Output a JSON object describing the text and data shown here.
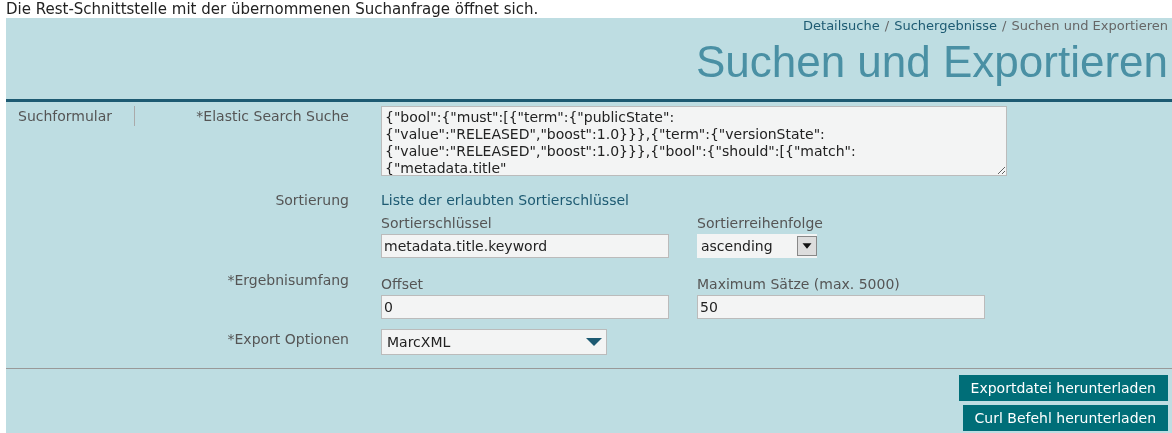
{
  "intro": "Die Rest-Schnittstelle mit der übernommenen Suchanfrage öffnet sich.",
  "breadcrumb": [
    {
      "label": "Detailsuche",
      "link": true
    },
    {
      "label": "/",
      "link": false
    },
    {
      "label": "Suchergebnisse",
      "link": true
    },
    {
      "label": "/",
      "link": false
    },
    {
      "label": "Suchen und Exportieren",
      "link": false
    }
  ],
  "title": "Suchen und Exportieren",
  "side_label": "Suchformular",
  "query": {
    "label": "*Elastic Search Suche",
    "value": "{\"bool\":{\"must\":[{\"term\":{\"publicState\":\n{\"value\":\"RELEASED\",\"boost\":1.0}}},{\"term\":{\"versionState\":\n{\"value\":\"RELEASED\",\"boost\":1.0}}},{\"bool\":{\"should\":[{\"match\":\n{\"metadata.title\""
  },
  "sorting": {
    "label": "Sortierung",
    "link": "Liste der erlaubten Sortierschlüssel",
    "key_label": "Sortierschlüssel",
    "key_value": "metadata.title.keyword",
    "order_label": "Sortierreihenfolge",
    "order_value": "ascending"
  },
  "range": {
    "label": "*Ergebnisumfang",
    "offset_label": "Offset",
    "offset_value": "0",
    "max_label": "Maximum Sätze (max. 5000)",
    "max_value": "50"
  },
  "export": {
    "label": "*Export Optionen",
    "value": "MarcXML"
  },
  "buttons": [
    "Exportdatei herunterladen",
    "Curl Befehl herunterladen"
  ]
}
